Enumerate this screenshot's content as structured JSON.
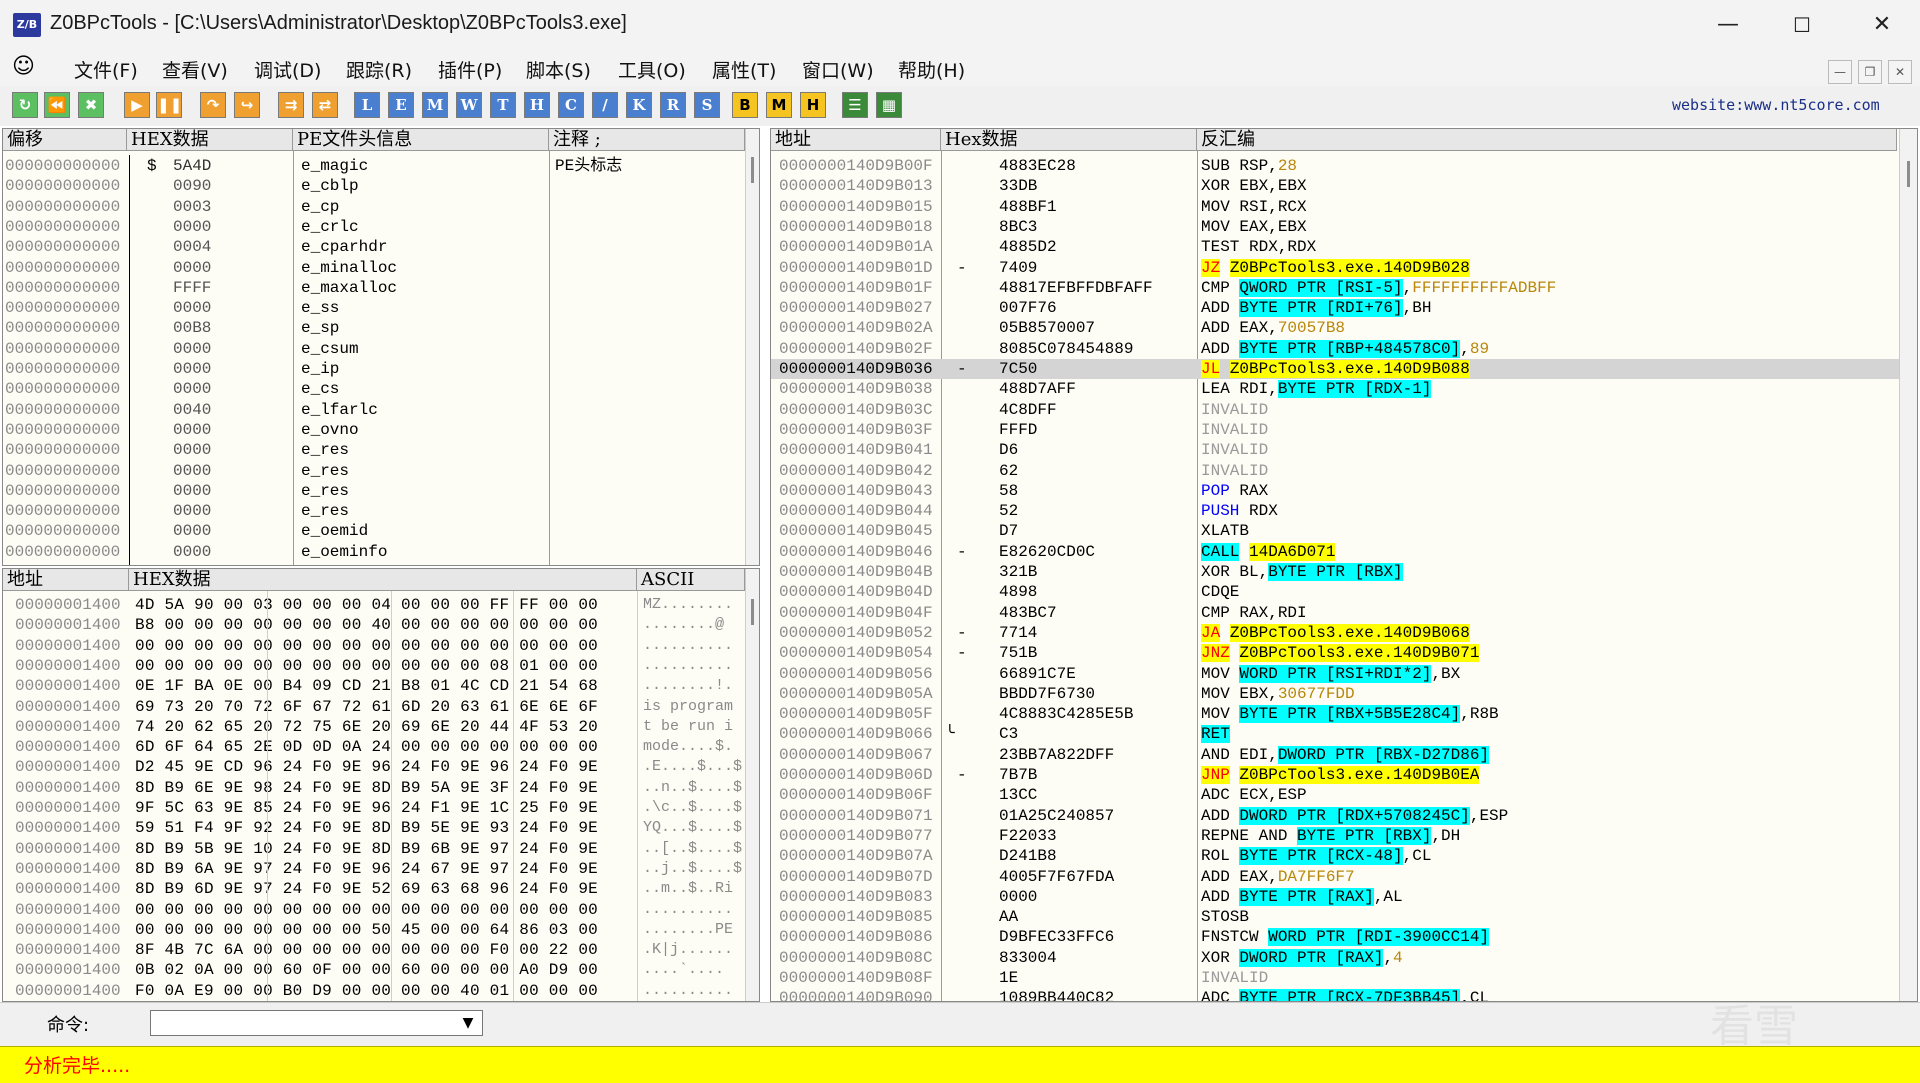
{
  "window": {
    "title": "Z0BPcTools - [C:\\Users\\Administrator\\Desktop\\Z0BPcTools3.exe]",
    "icon_text": "Z/B"
  },
  "menu": [
    "文件(F)",
    "查看(V)",
    "调试(D)",
    "跟踪(R)",
    "插件(P)",
    "脚本(S)",
    "工具(O)",
    "属性(T)",
    "窗口(W)",
    "帮助(H)"
  ],
  "toolbar": {
    "letter_buttons": [
      "L",
      "E",
      "M",
      "W",
      "T",
      "H",
      "C",
      "/",
      "K",
      "R",
      "S"
    ],
    "yellow_buttons": [
      "B",
      "M",
      "H"
    ],
    "website": "website:www.nt5core.com"
  },
  "pe_panel": {
    "headers": [
      "偏移",
      "HEX数据",
      "PE文件头信息",
      "注释 ;"
    ],
    "offset_text": "000000000000",
    "rows": [
      {
        "hex": "5A4D",
        "field": "e_magic",
        "note": "PE头标志"
      },
      {
        "hex": "0090",
        "field": "e_cblp",
        "note": ""
      },
      {
        "hex": "0003",
        "field": "e_cp",
        "note": ""
      },
      {
        "hex": "0000",
        "field": "e_crlc",
        "note": ""
      },
      {
        "hex": "0004",
        "field": "e_cparhdr",
        "note": ""
      },
      {
        "hex": "0000",
        "field": "e_minalloc",
        "note": ""
      },
      {
        "hex": "FFFF",
        "field": "e_maxalloc",
        "note": ""
      },
      {
        "hex": "0000",
        "field": "e_ss",
        "note": ""
      },
      {
        "hex": "00B8",
        "field": "e_sp",
        "note": ""
      },
      {
        "hex": "0000",
        "field": "e_csum",
        "note": ""
      },
      {
        "hex": "0000",
        "field": "e_ip",
        "note": ""
      },
      {
        "hex": "0000",
        "field": "e_cs",
        "note": ""
      },
      {
        "hex": "0040",
        "field": "e_lfarlc",
        "note": ""
      },
      {
        "hex": "0000",
        "field": "e_ovno",
        "note": ""
      },
      {
        "hex": "0000",
        "field": "e_res",
        "note": ""
      },
      {
        "hex": "0000",
        "field": "e_res",
        "note": ""
      },
      {
        "hex": "0000",
        "field": "e_res",
        "note": ""
      },
      {
        "hex": "0000",
        "field": "e_res",
        "note": ""
      },
      {
        "hex": "0000",
        "field": "e_oemid",
        "note": ""
      },
      {
        "hex": "0000",
        "field": "e_oeminfo",
        "note": ""
      }
    ]
  },
  "hex_panel": {
    "headers": [
      "地址",
      "HEX数据",
      "ASCII"
    ],
    "addr_text": "00000001400",
    "rows": [
      {
        "hex": "4D 5A 90 00 03 00 00 00 04 00 00 00 FF FF 00 00",
        "ascii": "MZ........"
      },
      {
        "hex": "B8 00 00 00 00 00 00 00 40 00 00 00 00 00 00 00",
        "ascii": "........@"
      },
      {
        "hex": "00 00 00 00 00 00 00 00 00 00 00 00 00 00 00 00",
        "ascii": ".........."
      },
      {
        "hex": "00 00 00 00 00 00 00 00 00 00 00 00 08 01 00 00",
        "ascii": ".........."
      },
      {
        "hex": "0E 1F BA 0E 00 B4 09 CD 21 B8 01 4C CD 21 54 68",
        "ascii": "........!."
      },
      {
        "hex": "69 73 20 70 72 6F 67 72 61 6D 20 63 61 6E 6E 6F",
        "ascii": "is program"
      },
      {
        "hex": "74 20 62 65 20 72 75 6E 20 69 6E 20 44 4F 53 20",
        "ascii": "t be run i"
      },
      {
        "hex": "6D 6F 64 65 2E 0D 0D 0A 24 00 00 00 00 00 00 00",
        "ascii": "mode....$."
      },
      {
        "hex": "D2 45 9E CD 96 24 F0 9E 96 24 F0 9E 96 24 F0 9E",
        "ascii": ".E....$...$"
      },
      {
        "hex": "8D B9 6E 9E 98 24 F0 9E 8D B9 5A 9E 3F 24 F0 9E",
        "ascii": "..n..$....$"
      },
      {
        "hex": "9F 5C 63 9E 85 24 F0 9E 96 24 F1 9E 1C 25 F0 9E",
        "ascii": ".\\c..$....$"
      },
      {
        "hex": "59 51 F4 9F 92 24 F0 9E 8D B9 5E 9E 93 24 F0 9E",
        "ascii": "YQ...$....$"
      },
      {
        "hex": "8D B9 5B 9E 10 24 F0 9E 8D B9 6B 9E 97 24 F0 9E",
        "ascii": "..[..$....$"
      },
      {
        "hex": "8D B9 6A 9E 97 24 F0 9E 96 24 67 9E 97 24 F0 9E",
        "ascii": "..j..$....$"
      },
      {
        "hex": "8D B9 6D 9E 97 24 F0 9E 52 69 63 68 96 24 F0 9E",
        "ascii": "..m..$..Ri"
      },
      {
        "hex": "00 00 00 00 00 00 00 00 00 00 00 00 00 00 00 00",
        "ascii": ".........."
      },
      {
        "hex": "00 00 00 00 00 00 00 00 50 45 00 00 64 86 03 00",
        "ascii": "........PE"
      },
      {
        "hex": "8F 4B 7C 6A 00 00 00 00 00 00 00 00 F0 00 22 00",
        "ascii": ".K|j......"
      },
      {
        "hex": "0B 02 0A 00 00 60 0F 00 00 60 00 00 00 A0 D9 00",
        "ascii": "....`...."
      },
      {
        "hex": "F0 0A E9 00 00 B0 D9 00 00 00 00 40 01 00 00 00",
        "ascii": ".........."
      }
    ]
  },
  "disasm_panel": {
    "headers": [
      "地址",
      "Hex数据",
      "反汇编"
    ],
    "rows": [
      {
        "addr": "0000000140D9B00F",
        "mark": "",
        "hex": "4883EC28",
        "asm": [
          [
            "",
            "SUB RSP,"
          ],
          [
            "num",
            "28"
          ]
        ]
      },
      {
        "addr": "0000000140D9B013",
        "mark": "",
        "hex": "33DB",
        "asm": [
          [
            "",
            "XOR EBX,EBX"
          ]
        ]
      },
      {
        "addr": "0000000140D9B015",
        "mark": "",
        "hex": "488BF1",
        "asm": [
          [
            "",
            "MOV RSI,RCX"
          ]
        ]
      },
      {
        "addr": "0000000140D9B018",
        "mark": "",
        "hex": "8BC3",
        "asm": [
          [
            "",
            "MOV EAX,EBX"
          ]
        ]
      },
      {
        "addr": "0000000140D9B01A",
        "mark": "",
        "hex": "4885D2",
        "asm": [
          [
            "",
            "TEST RDX,RDX"
          ]
        ]
      },
      {
        "addr": "0000000140D9B01D",
        "mark": "-",
        "hex": "7409",
        "asm": [
          [
            "op-red hl-y",
            "JZ"
          ],
          [
            "",
            " "
          ],
          [
            "hl-y",
            "Z0BPcTools3.exe.140D9B028"
          ]
        ]
      },
      {
        "addr": "0000000140D9B01F",
        "mark": "",
        "hex": "48817EFBFFDBFAFF",
        "asm": [
          [
            "",
            "CMP "
          ],
          [
            "hl-c",
            "QWORD PTR [RSI-5]"
          ],
          [
            "",
            ","
          ],
          [
            "num",
            "FFFFFFFFFFADBFF"
          ]
        ]
      },
      {
        "addr": "0000000140D9B027",
        "mark": "",
        "hex": "007F76",
        "asm": [
          [
            "",
            "ADD "
          ],
          [
            "hl-c",
            "BYTE PTR [RDI+76]"
          ],
          [
            "",
            ",BH"
          ]
        ]
      },
      {
        "addr": "0000000140D9B02A",
        "mark": "",
        "hex": "05B8570007",
        "asm": [
          [
            "",
            "ADD EAX,"
          ],
          [
            "num",
            "70057B8"
          ]
        ]
      },
      {
        "addr": "0000000140D9B02F",
        "mark": "",
        "hex": "8085C078454889",
        "asm": [
          [
            "",
            "ADD "
          ],
          [
            "hl-c",
            "BYTE PTR [RBP+484578C0]"
          ],
          [
            "",
            ","
          ],
          [
            "num",
            "89"
          ]
        ]
      },
      {
        "addr": "0000000140D9B036",
        "mark": "-",
        "hex": "7C50",
        "asm": [
          [
            "op-red hl-y",
            "JL"
          ],
          [
            "",
            " "
          ],
          [
            "hl-y",
            "Z0BPcTools3.exe.140D9B088"
          ]
        ],
        "selected": true
      },
      {
        "addr": "0000000140D9B038",
        "mark": "",
        "hex": "488D7AFF",
        "asm": [
          [
            "",
            "LEA RDI,"
          ],
          [
            "hl-c",
            "BYTE PTR [RDX-1]"
          ]
        ]
      },
      {
        "addr": "0000000140D9B03C",
        "mark": "",
        "hex": "4C8DFF",
        "asm": [
          [
            "inv",
            "INVALID"
          ]
        ]
      },
      {
        "addr": "0000000140D9B03F",
        "mark": "",
        "hex": "FFFD",
        "asm": [
          [
            "inv",
            "INVALID"
          ]
        ]
      },
      {
        "addr": "0000000140D9B041",
        "mark": "",
        "hex": "D6",
        "asm": [
          [
            "inv",
            "INVALID"
          ]
        ]
      },
      {
        "addr": "0000000140D9B042",
        "mark": "",
        "hex": "62",
        "asm": [
          [
            "inv",
            "INVALID"
          ]
        ]
      },
      {
        "addr": "0000000140D9B043",
        "mark": "",
        "hex": "58",
        "asm": [
          [
            "op-blue",
            "POP"
          ],
          [
            "",
            " RAX"
          ]
        ]
      },
      {
        "addr": "0000000140D9B044",
        "mark": "",
        "hex": "52",
        "asm": [
          [
            "op-blue",
            "PUSH"
          ],
          [
            "",
            " RDX"
          ]
        ]
      },
      {
        "addr": "0000000140D9B045",
        "mark": "",
        "hex": "D7",
        "asm": [
          [
            "",
            "XLATB"
          ]
        ]
      },
      {
        "addr": "0000000140D9B046",
        "mark": "-",
        "hex": "E82620CD0C",
        "asm": [
          [
            "hl-c",
            "CALL"
          ],
          [
            "",
            " "
          ],
          [
            "hl-y",
            "14DA6D071"
          ]
        ]
      },
      {
        "addr": "0000000140D9B04B",
        "mark": "",
        "hex": "321B",
        "asm": [
          [
            "",
            "XOR BL,"
          ],
          [
            "hl-c",
            "BYTE PTR [RBX]"
          ]
        ]
      },
      {
        "addr": "0000000140D9B04D",
        "mark": "",
        "hex": "4898",
        "asm": [
          [
            "",
            "CDQE"
          ]
        ]
      },
      {
        "addr": "0000000140D9B04F",
        "mark": "",
        "hex": "483BC7",
        "asm": [
          [
            "",
            "CMP RAX,RDI"
          ]
        ]
      },
      {
        "addr": "0000000140D9B052",
        "mark": "-",
        "hex": "7714",
        "asm": [
          [
            "op-red hl-y",
            "JA"
          ],
          [
            "",
            " "
          ],
          [
            "hl-y",
            "Z0BPcTools3.exe.140D9B068"
          ]
        ]
      },
      {
        "addr": "0000000140D9B054",
        "mark": "-",
        "hex": "751B",
        "asm": [
          [
            "op-red hl-y",
            "JNZ"
          ],
          [
            "",
            " "
          ],
          [
            "hl-y",
            "Z0BPcTools3.exe.140D9B071"
          ]
        ]
      },
      {
        "addr": "0000000140D9B056",
        "mark": "",
        "hex": "66891C7E",
        "asm": [
          [
            "",
            "MOV "
          ],
          [
            "hl-c",
            "WORD PTR [RSI+RDI*2]"
          ],
          [
            "",
            ",BX"
          ]
        ]
      },
      {
        "addr": "0000000140D9B05A",
        "mark": "",
        "hex": "BBDD7F6730",
        "asm": [
          [
            "",
            "MOV EBX,"
          ],
          [
            "num",
            "30677FDD"
          ]
        ]
      },
      {
        "addr": "0000000140D9B05F",
        "mark": "",
        "hex": "4C8883C4285E5B",
        "asm": [
          [
            "",
            "MOV "
          ],
          [
            "hl-c",
            "BYTE PTR [RBX+5B5E28C4]"
          ],
          [
            "",
            ",R8B"
          ]
        ]
      },
      {
        "addr": "0000000140D9B066",
        "mark": "ret",
        "hex": "C3",
        "asm": [
          [
            "hl-c",
            "RET"
          ]
        ]
      },
      {
        "addr": "0000000140D9B067",
        "mark": "",
        "hex": "23BB7A822DFF",
        "asm": [
          [
            "",
            "AND EDI,"
          ],
          [
            "hl-c",
            "DWORD PTR [RBX-D27D86]"
          ]
        ]
      },
      {
        "addr": "0000000140D9B06D",
        "mark": "-",
        "hex": "7B7B",
        "asm": [
          [
            "op-red hl-y",
            "JNP"
          ],
          [
            "",
            " "
          ],
          [
            "hl-y",
            "Z0BPcTools3.exe.140D9B0EA"
          ]
        ]
      },
      {
        "addr": "0000000140D9B06F",
        "mark": "",
        "hex": "13CC",
        "asm": [
          [
            "",
            "ADC ECX,ESP"
          ]
        ]
      },
      {
        "addr": "0000000140D9B071",
        "mark": "",
        "hex": "01A25C240857",
        "asm": [
          [
            "",
            "ADD "
          ],
          [
            "hl-c",
            "DWORD PTR [RDX+5708245C]"
          ],
          [
            "",
            ",ESP"
          ]
        ]
      },
      {
        "addr": "0000000140D9B077",
        "mark": "",
        "hex": "F22033",
        "asm": [
          [
            "",
            "REPNE AND "
          ],
          [
            "hl-c",
            "BYTE PTR [RBX]"
          ],
          [
            "",
            ",DH"
          ]
        ]
      },
      {
        "addr": "0000000140D9B07A",
        "mark": "",
        "hex": "D241B8",
        "asm": [
          [
            "",
            "ROL "
          ],
          [
            "hl-c",
            "BYTE PTR [RCX-48]"
          ],
          [
            "",
            ",CL"
          ]
        ]
      },
      {
        "addr": "0000000140D9B07D",
        "mark": "",
        "hex": "4005F7F67FDA",
        "asm": [
          [
            "",
            "ADD EAX,"
          ],
          [
            "num",
            "DA7FF6F7"
          ]
        ]
      },
      {
        "addr": "0000000140D9B083",
        "mark": "",
        "hex": "0000",
        "asm": [
          [
            "",
            "ADD "
          ],
          [
            "hl-c",
            "BYTE PTR [RAX]"
          ],
          [
            "",
            ",AL"
          ]
        ]
      },
      {
        "addr": "0000000140D9B085",
        "mark": "",
        "hex": "AA",
        "asm": [
          [
            "",
            "STOSB"
          ]
        ]
      },
      {
        "addr": "0000000140D9B086",
        "mark": "",
        "hex": "D9BFEC33FFC6",
        "asm": [
          [
            "",
            "FNSTCW "
          ],
          [
            "hl-c",
            "WORD PTR [RDI-3900CC14]"
          ]
        ]
      },
      {
        "addr": "0000000140D9B08C",
        "mark": "",
        "hex": "833004",
        "asm": [
          [
            "",
            "XOR "
          ],
          [
            "hl-c",
            "DWORD PTR [RAX]"
          ],
          [
            "",
            ","
          ],
          [
            "num",
            "4"
          ]
        ]
      },
      {
        "addr": "0000000140D9B08F",
        "mark": "",
        "hex": "1E",
        "asm": [
          [
            "inv",
            "INVALID"
          ]
        ]
      },
      {
        "addr": "0000000140D9B090",
        "mark": "",
        "hex": "1089BB440C82",
        "asm": [
          [
            "",
            "ADC "
          ],
          [
            "hl-c",
            "BYTE PTR [RCX-7DF3BB45]"
          ],
          [
            "",
            ",CL"
          ]
        ]
      }
    ]
  },
  "command": {
    "label": "命令:",
    "value": ""
  },
  "status": {
    "text": "分析完毕....."
  },
  "watermark": "看雪"
}
